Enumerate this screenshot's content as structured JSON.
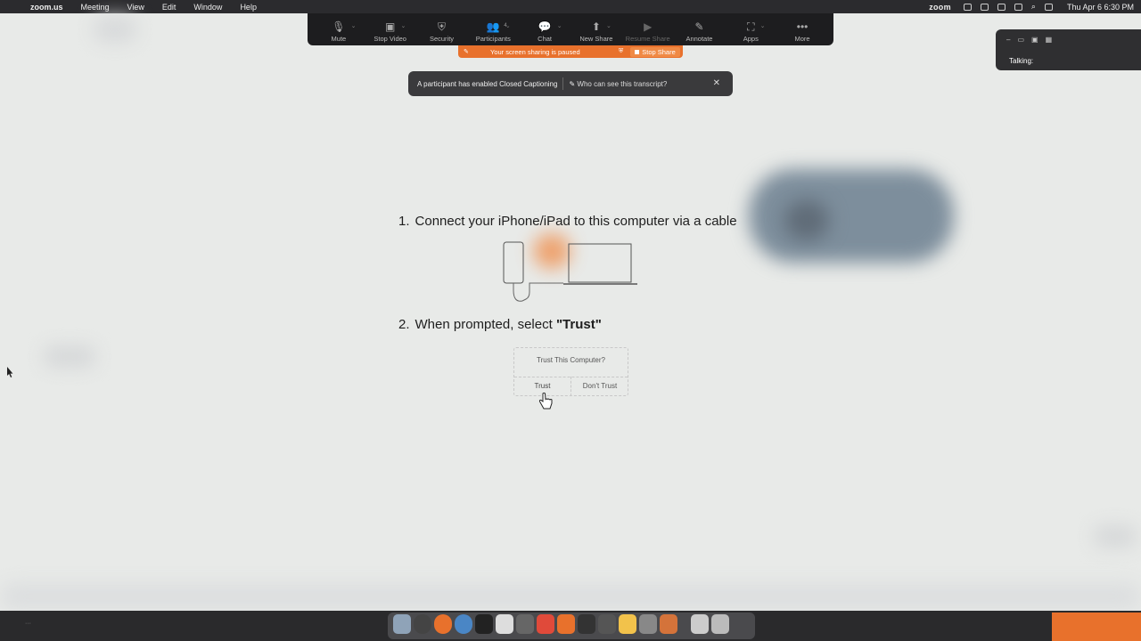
{
  "menubar": {
    "app_name": "zoom.us",
    "items": [
      "Meeting",
      "View",
      "Edit",
      "Window",
      "Help"
    ],
    "zoom_label": "zoom",
    "clock": "Thu Apr 6  6:30 PM"
  },
  "zoom_toolbar": {
    "mute": "Mute",
    "stop_video": "Stop Video",
    "security": "Security",
    "participants": "Participants",
    "participants_count": "4",
    "chat": "Chat",
    "new_share": "New Share",
    "resume_share": "Resume Share",
    "annotate": "Annotate",
    "apps": "Apps",
    "more": "More"
  },
  "share_bar": {
    "message": "Your screen sharing is paused",
    "stop_label": "Stop Share"
  },
  "cc_banner": {
    "message": "A participant has enabled Closed Captioning",
    "link": "Who can see this transcript?"
  },
  "talk_panel": {
    "label": "Talking:"
  },
  "instructions": {
    "step1_num": "1.",
    "step1_text": "Connect your iPhone/iPad to this computer via a cable",
    "step2_num": "2.",
    "step2_prefix": "When prompted, select ",
    "step2_bold": "\"Trust\""
  },
  "trust_dialog": {
    "question": "Trust This Computer?",
    "trust": "Trust",
    "dont_trust": "Don't Trust"
  },
  "colors": {
    "share_orange": "#e8712c",
    "toolbar_bg": "#1d1d1f",
    "background": "#e8eae8"
  },
  "dock": {
    "icons": [
      "finder-icon",
      "launchpad-icon",
      "chrome-icon",
      "terminal-icon",
      "keynote-icon",
      "preview-icon",
      "acrobat-icon",
      "zoom-icon",
      "word-icon",
      "calculator-icon",
      "photos-icon",
      "editor-icon",
      "app-icon",
      "documents-icon",
      "trash-icon"
    ]
  }
}
